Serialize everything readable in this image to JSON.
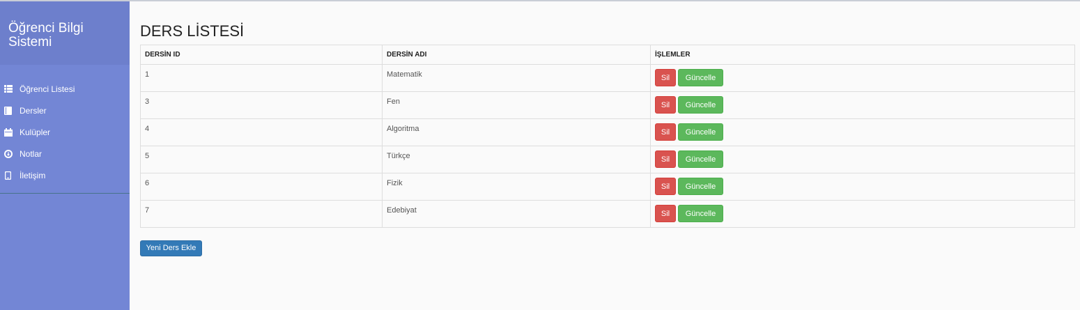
{
  "sidebar": {
    "title": "Öğrenci Bilgi Sistemi",
    "items": [
      {
        "label": "Öğrenci Listesi",
        "icon": "list-icon"
      },
      {
        "label": "Dersler",
        "icon": "book-icon"
      },
      {
        "label": "Kulüpler",
        "icon": "calendar-icon"
      },
      {
        "label": "Notlar",
        "icon": "dashboard-icon"
      },
      {
        "label": "İletişim",
        "icon": "phone-icon"
      }
    ]
  },
  "main": {
    "title": "DERS LİSTESİ",
    "columns": [
      "DERSİN ID",
      "DERSİN ADI",
      "İŞLEMLER"
    ],
    "rows": [
      {
        "id": "1",
        "name": "Matematik"
      },
      {
        "id": "3",
        "name": "Fen"
      },
      {
        "id": "4",
        "name": "Algoritma"
      },
      {
        "id": "5",
        "name": "Türkçe"
      },
      {
        "id": "6",
        "name": "Fizik"
      },
      {
        "id": "7",
        "name": "Edebiyat"
      }
    ],
    "delete_label": "Sil",
    "update_label": "Güncelle",
    "add_label": "Yeni Ders Ekle"
  },
  "colors": {
    "sidebar": "#7386d5",
    "sidebar_header": "#6d7fcc",
    "danger": "#d9534f",
    "success": "#5cb85c",
    "primary": "#337ab7"
  }
}
